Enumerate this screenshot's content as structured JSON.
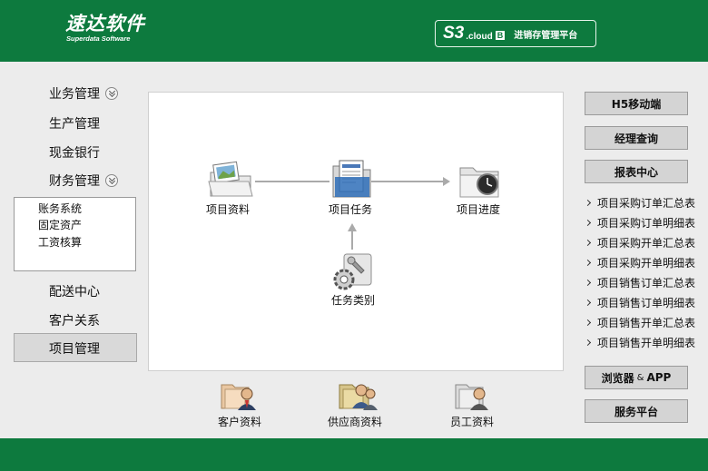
{
  "header": {
    "logo_text": "速达软件",
    "logo_sub": "Superdata Software",
    "product_s3": "S3",
    "product_cloud": ".cloud",
    "product_edition": "B",
    "product_slogan": "进销存管理平台"
  },
  "sidebar": {
    "items": [
      {
        "label": "业务管理"
      },
      {
        "label": "生产管理"
      },
      {
        "label": "现金银行"
      },
      {
        "label": "财务管理"
      },
      {
        "label": "配送中心"
      },
      {
        "label": "客户关系"
      },
      {
        "label": "项目管理"
      }
    ],
    "finance_sub": [
      "账务系统",
      "固定资产",
      "工资核算"
    ]
  },
  "workflow": {
    "project_info": "项目资料",
    "project_task": "项目任务",
    "project_progress": "项目进度",
    "task_category": "任务类别"
  },
  "bottom": {
    "customer": "客户资料",
    "supplier": "供应商资料",
    "employee": "员工资料"
  },
  "right": {
    "h5": "H5移动端",
    "manager": "经理查询",
    "reports": "报表中心",
    "report_links": [
      "项目采购订单汇总表",
      "项目采购订单明细表",
      "项目采购开单汇总表",
      "项目采购开单明细表",
      "项目销售订单汇总表",
      "项目销售订单明细表",
      "项目销售开单汇总表",
      "项目销售开单明细表"
    ],
    "browser_a": "浏览器",
    "browser_amp": "&",
    "browser_b": "APP",
    "service": "服务平台"
  },
  "colors": {
    "brand_green": "#0d7a3e",
    "background": "#ececec",
    "active_nav": "#d9d9d9"
  }
}
